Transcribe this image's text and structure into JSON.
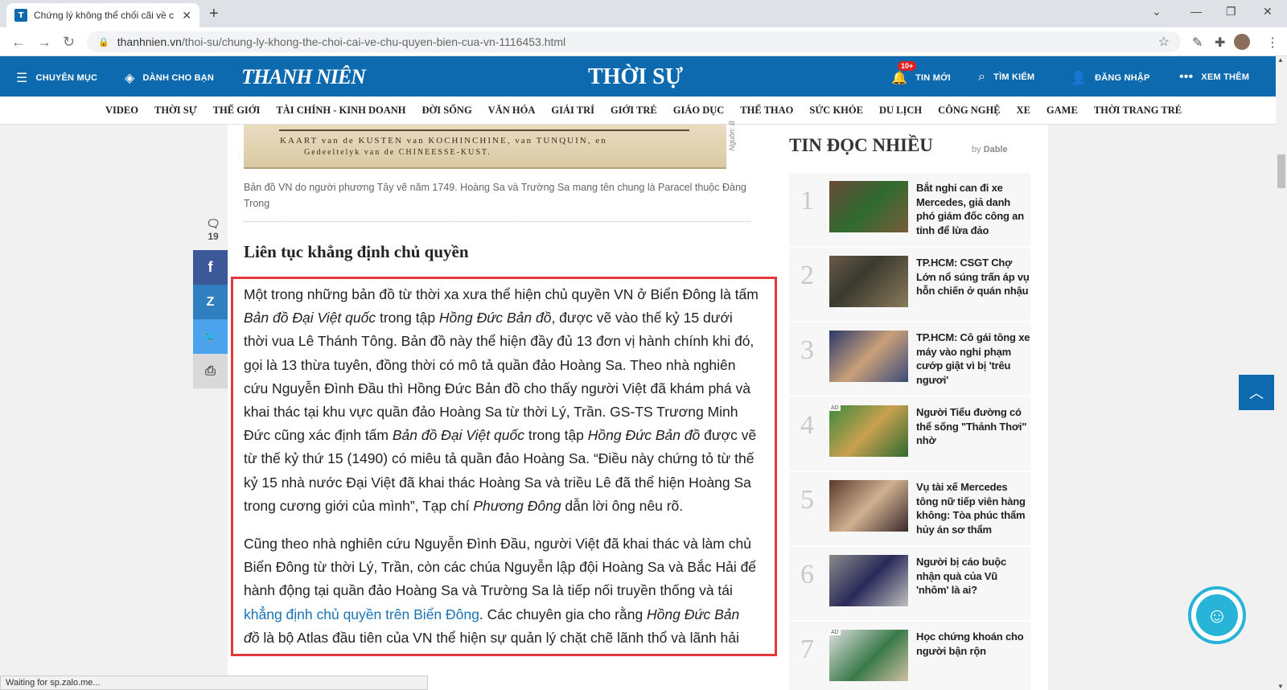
{
  "browser": {
    "tab_title": "Chứng lý không thể chối cãi về c",
    "tab_favicon": "T",
    "url_host": "thanhnien.vn",
    "url_path": "/thoi-su/chung-ly-khong-the-choi-cai-ve-chu-quyen-bien-cua-vn-1116453.html",
    "status": "Waiting for sp.zalo.me..."
  },
  "header": {
    "menu_label": "CHUYÊN MỤC",
    "for_you_label": "DÀNH CHO BẠN",
    "logo": "THANH NIÊN",
    "section": "THỜI SỰ",
    "news_badge": "10+",
    "news_label": "TIN MỚI",
    "search_label": "TÌM KIẾM",
    "login_label": "ĐĂNG NHẬP",
    "more_label": "XEM THÊM",
    "brand_color": "#0d6aae"
  },
  "categories": [
    "VIDEO",
    "THỜI SỰ",
    "THẾ GIỚI",
    "TÀI CHÍNH - KINH DOANH",
    "ĐỜI SỐNG",
    "VĂN HÓA",
    "GIẢI TRÍ",
    "GIỚI TRẺ",
    "GIÁO DỤC",
    "THỂ THAO",
    "SỨC KHỎE",
    "DU LỊCH",
    "CÔNG NGHỆ",
    "XE",
    "GAME",
    "THỜI TRANG TRẺ"
  ],
  "article": {
    "map_caption_line1": "KAART van de KUSTEN van KOCHINCHINE, van TUNQUIN, en",
    "map_caption_line2": "Gedeeltelyk van de CHINEESSE-KUST.",
    "image_source": "Nguồn: B",
    "image_caption": "Bản đồ VN do người phương Tây vẽ năm 1749. Hoàng Sa và Trường Sa mang tên chung là Paracel thuộc Đàng Trong",
    "subheading": "Liên tục khẳng định chủ quyền",
    "p1_a": "Một trong những bản đồ từ thời xa xưa thể hiện chủ quyền VN ở Biển Đông là tấm ",
    "p1_i1": "Bản đồ Đại Việt quốc",
    "p1_b": " trong tập ",
    "p1_i2": "Hồng Đức Bản đồ",
    "p1_c": ", được vẽ vào thế kỷ 15 dưới thời vua Lê Thánh Tông. Bản đồ này thể hiện đầy đủ 13 đơn vị hành chính khi đó, gọi là 13 thừa tuyên, đồng thời có mô tả quần đảo Hoàng Sa. Theo nhà nghiên cứu Nguyễn Đình Đầu thì Hồng Đức Bản đồ cho thấy người Việt đã khám phá và khai thác tại khu vực quần đảo Hoàng Sa từ thời Lý, Trần. GS-TS Trương Minh Đức cũng xác định tấm ",
    "p1_i3": "Bản đồ Đại Việt quốc",
    "p1_d": " trong tập ",
    "p1_i4": "Hồng Đức Bản đồ",
    "p1_e": " được vẽ từ thế kỷ thứ 15 (1490) có miêu tả quần đảo Hoàng Sa. “Điều này chứng tỏ từ thế kỷ 15 nhà nước Đại Việt đã khai thác Hoàng Sa và triều Lê đã thể hiện Hoàng Sa trong cương giới của mình”, Tạp chí ",
    "p1_i5": "Phương Đông",
    "p1_f": " dẫn lời ông nêu rõ.",
    "p2_a": "Cũng theo nhà nghiên cứu Nguyễn Đình Đầu, người Việt đã khai thác và làm chủ Biển Đông từ thời Lý, Trần, còn các chúa Nguyễn lập đội Hoàng Sa và Bắc Hải để hành động tại quần đảo Hoàng Sa và Trường Sa là tiếp nối truyền thống và tái ",
    "p2_link": "khẳng định chủ quyền trên Biển Đông",
    "p2_b": ". Các chuyên gia cho rằng ",
    "p2_i1": "Hồng Đức Bản đồ",
    "p2_c": " là bộ Atlas đầu tiên của VN thể hiện sự quản lý chặt chẽ lãnh thổ và lãnh hải",
    "highlight_color": "#e03a3e"
  },
  "share": {
    "comment_count": "19",
    "facebook": "f",
    "zalo": "Z",
    "twitter": "t",
    "print": "print-icon"
  },
  "sidebar": {
    "title": "TIN ĐỌC NHIỀU",
    "by": "by",
    "provider": "Dable",
    "items": [
      {
        "num": "1",
        "title": "Bắt nghi can đi xe Mercedes, giả danh phó giám đốc công an tỉnh để lừa đảo",
        "ad": ""
      },
      {
        "num": "2",
        "title": "TP.HCM: CSGT Chợ Lớn nổ súng trấn áp vụ hỗn chiến ở quán nhậu",
        "ad": ""
      },
      {
        "num": "3",
        "title": "TP.HCM: Cô gái tông xe máy vào nghi phạm cướp giật vì bị 'trêu ngươi'",
        "ad": ""
      },
      {
        "num": "4",
        "title": "Người Tiểu đường có thể sống \"Thảnh Thơi\" nhờ",
        "ad": "AD"
      },
      {
        "num": "5",
        "title": "Vụ tài xế Mercedes tông nữ tiếp viên hàng không: Tòa phúc thẩm hủy án sơ thẩm",
        "ad": ""
      },
      {
        "num": "6",
        "title": "Người bị cáo buộc nhận quà của Vũ 'nhôm' là ai?",
        "ad": ""
      },
      {
        "num": "7",
        "title": "Học chứng khoán cho người bận rộn",
        "ad": "AD"
      }
    ]
  }
}
